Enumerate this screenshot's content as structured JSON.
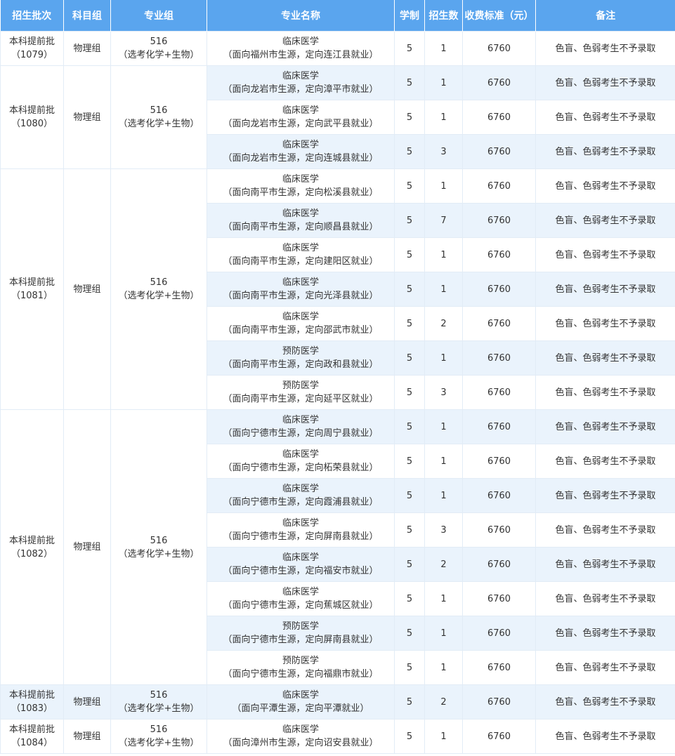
{
  "header": {
    "batch": "招生批次",
    "subject": "科目组",
    "group": "专业组",
    "major": "专业名称",
    "years": "学制",
    "quota": "招生数",
    "fee": "收费标准（元）",
    "note": "备注"
  },
  "groups": [
    {
      "batch": "本科提前批",
      "code": "（1079）",
      "subject": "物理组",
      "group_no": "516",
      "requirement": "（选考化学+生物）",
      "rows": [
        {
          "major": "临床医学",
          "direction": "（面向福州市生源，定向连江县就业）",
          "years": "5",
          "quota": "1",
          "fee": "6760",
          "note": "色盲、色弱考生不予录取"
        }
      ]
    },
    {
      "batch": "本科提前批",
      "code": "（1080）",
      "subject": "物理组",
      "group_no": "516",
      "requirement": "（选考化学+生物）",
      "rows": [
        {
          "major": "临床医学",
          "direction": "（面向龙岩市生源，定向漳平市就业）",
          "years": "5",
          "quota": "1",
          "fee": "6760",
          "note": "色盲、色弱考生不予录取"
        },
        {
          "major": "临床医学",
          "direction": "（面向龙岩市生源，定向武平县就业）",
          "years": "5",
          "quota": "1",
          "fee": "6760",
          "note": "色盲、色弱考生不予录取"
        },
        {
          "major": "临床医学",
          "direction": "（面向龙岩市生源，定向连城县就业）",
          "years": "5",
          "quota": "3",
          "fee": "6760",
          "note": "色盲、色弱考生不予录取"
        }
      ]
    },
    {
      "batch": "本科提前批",
      "code": "（1081）",
      "subject": "物理组",
      "group_no": "516",
      "requirement": "（选考化学+生物）",
      "rows": [
        {
          "major": "临床医学",
          "direction": "（面向南平市生源，定向松溪县就业）",
          "years": "5",
          "quota": "1",
          "fee": "6760",
          "note": "色盲、色弱考生不予录取"
        },
        {
          "major": "临床医学",
          "direction": "（面向南平市生源，定向顺昌县就业）",
          "years": "5",
          "quota": "7",
          "fee": "6760",
          "note": "色盲、色弱考生不予录取"
        },
        {
          "major": "临床医学",
          "direction": "（面向南平市生源，定向建阳区就业）",
          "years": "5",
          "quota": "1",
          "fee": "6760",
          "note": "色盲、色弱考生不予录取"
        },
        {
          "major": "临床医学",
          "direction": "（面向南平市生源，定向光泽县就业）",
          "years": "5",
          "quota": "1",
          "fee": "6760",
          "note": "色盲、色弱考生不予录取"
        },
        {
          "major": "临床医学",
          "direction": "（面向南平市生源，定向邵武市就业）",
          "years": "5",
          "quota": "2",
          "fee": "6760",
          "note": "色盲、色弱考生不予录取"
        },
        {
          "major": "预防医学",
          "direction": "（面向南平市生源，定向政和县就业）",
          "years": "5",
          "quota": "1",
          "fee": "6760",
          "note": "色盲、色弱考生不予录取"
        },
        {
          "major": "预防医学",
          "direction": "（面向南平市生源，定向延平区就业）",
          "years": "5",
          "quota": "3",
          "fee": "6760",
          "note": "色盲、色弱考生不予录取"
        }
      ]
    },
    {
      "batch": "本科提前批",
      "code": "（1082）",
      "subject": "物理组",
      "group_no": "516",
      "requirement": "（选考化学+生物）",
      "rows": [
        {
          "major": "临床医学",
          "direction": "（面向宁德市生源，定向周宁县就业）",
          "years": "5",
          "quota": "1",
          "fee": "6760",
          "note": "色盲、色弱考生不予录取"
        },
        {
          "major": "临床医学",
          "direction": "（面向宁德市生源，定向柘荣县就业）",
          "years": "5",
          "quota": "1",
          "fee": "6760",
          "note": "色盲、色弱考生不予录取"
        },
        {
          "major": "临床医学",
          "direction": "（面向宁德市生源，定向霞浦县就业）",
          "years": "5",
          "quota": "1",
          "fee": "6760",
          "note": "色盲、色弱考生不予录取"
        },
        {
          "major": "临床医学",
          "direction": "（面向宁德市生源，定向屏南县就业）",
          "years": "5",
          "quota": "3",
          "fee": "6760",
          "note": "色盲、色弱考生不予录取"
        },
        {
          "major": "临床医学",
          "direction": "（面向宁德市生源，定向福安市就业）",
          "years": "5",
          "quota": "2",
          "fee": "6760",
          "note": "色盲、色弱考生不予录取"
        },
        {
          "major": "临床医学",
          "direction": "（面向宁德市生源，定向蕉城区就业）",
          "years": "5",
          "quota": "1",
          "fee": "6760",
          "note": "色盲、色弱考生不予录取"
        },
        {
          "major": "预防医学",
          "direction": "（面向宁德市生源，定向屏南县就业）",
          "years": "5",
          "quota": "1",
          "fee": "6760",
          "note": "色盲、色弱考生不予录取"
        },
        {
          "major": "预防医学",
          "direction": "（面向宁德市生源，定向福鼎市就业）",
          "years": "5",
          "quota": "1",
          "fee": "6760",
          "note": "色盲、色弱考生不予录取"
        }
      ]
    },
    {
      "batch": "本科提前批",
      "code": "（1083）",
      "subject": "物理组",
      "group_no": "516",
      "requirement": "（选考化学+生物）",
      "rows": [
        {
          "major": "临床医学",
          "direction": "（面向平潭生源，定向平潭就业）",
          "years": "5",
          "quota": "2",
          "fee": "6760",
          "note": "色盲、色弱考生不予录取"
        }
      ]
    },
    {
      "batch": "本科提前批",
      "code": "（1084）",
      "subject": "物理组",
      "group_no": "516",
      "requirement": "（选考化学+生物）",
      "rows": [
        {
          "major": "临床医学",
          "direction": "（面向漳州市生源，定向诏安县就业）",
          "years": "5",
          "quota": "1",
          "fee": "6760",
          "note": "色盲、色弱考生不予录取"
        }
      ]
    }
  ]
}
